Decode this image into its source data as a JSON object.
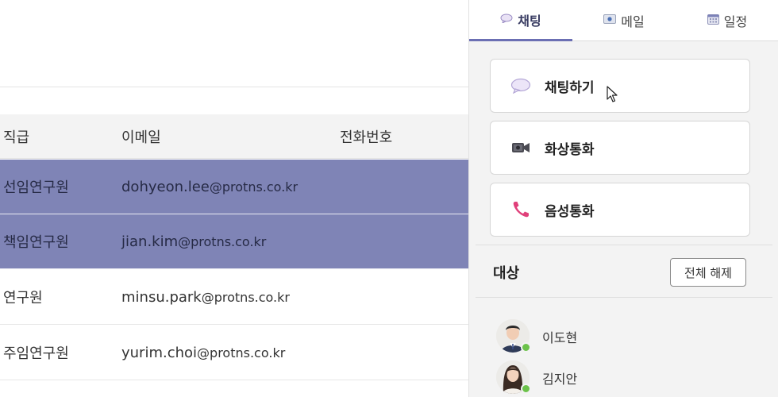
{
  "table": {
    "headers": {
      "rank": "직급",
      "email": "이메일",
      "phone": "전화번호"
    },
    "rows": [
      {
        "rank": "선임연구원",
        "email_user": "dohyeon.lee",
        "email_domain": "@protns.co.kr",
        "phone": "",
        "selected": true
      },
      {
        "rank": "책임연구원",
        "email_user": "jian.kim",
        "email_domain": "@protns.co.kr",
        "phone": "",
        "selected": true
      },
      {
        "rank": "연구원",
        "email_user": "minsu.park",
        "email_domain": " @protns.co.kr",
        "phone": "",
        "selected": false
      },
      {
        "rank": "주임연구원",
        "email_user": "yurim.choi",
        "email_domain": " @protns.co.kr",
        "phone": "",
        "selected": false
      }
    ]
  },
  "panel": {
    "tabs": [
      {
        "label": "채팅",
        "icon": "speech-bubble-icon",
        "active": true
      },
      {
        "label": "메일",
        "icon": "mail-icon",
        "active": false
      },
      {
        "label": "일정",
        "icon": "calendar-icon",
        "active": false
      }
    ],
    "actions": [
      {
        "label": "채팅하기",
        "icon": "chat-bubble-icon"
      },
      {
        "label": "화상통화",
        "icon": "video-camera-icon"
      },
      {
        "label": "음성통화",
        "icon": "phone-icon"
      }
    ],
    "target_label": "대상",
    "clear_button": "전체 해제",
    "people": [
      {
        "name": "이도현",
        "status": "online"
      },
      {
        "name": "김지안",
        "status": "online"
      }
    ]
  },
  "colors": {
    "selected_row": "#7f84b6",
    "active_tab_accent": "#6b6fb3",
    "online": "#6cc24a",
    "phone_icon": "#e0407a"
  }
}
